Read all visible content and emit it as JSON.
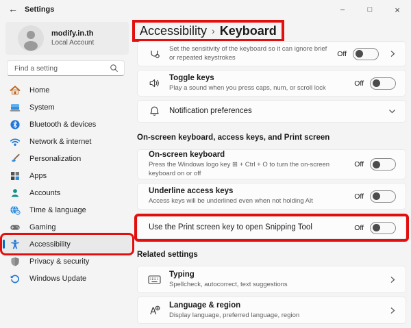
{
  "titlebar": {
    "back": "←",
    "title": "Settings",
    "minimize": "–",
    "maximize": "□",
    "close": "×"
  },
  "account": {
    "name": "modify.in.th",
    "type": "Local Account"
  },
  "search": {
    "placeholder": "Find a setting"
  },
  "sidebar": {
    "items": [
      {
        "label": "Home",
        "icon": "home-icon"
      },
      {
        "label": "System",
        "icon": "system-icon"
      },
      {
        "label": "Bluetooth & devices",
        "icon": "bluetooth-icon"
      },
      {
        "label": "Network & internet",
        "icon": "network-icon"
      },
      {
        "label": "Personalization",
        "icon": "personalization-icon"
      },
      {
        "label": "Apps",
        "icon": "apps-icon"
      },
      {
        "label": "Accounts",
        "icon": "accounts-icon"
      },
      {
        "label": "Time & language",
        "icon": "time-language-icon"
      },
      {
        "label": "Gaming",
        "icon": "gaming-icon"
      },
      {
        "label": "Accessibility",
        "icon": "accessibility-icon",
        "selected": true,
        "annotated": true
      },
      {
        "label": "Privacy & security",
        "icon": "privacy-icon"
      },
      {
        "label": "Windows Update",
        "icon": "windows-update-icon"
      }
    ]
  },
  "breadcrumb": {
    "parent": "Accessibility",
    "separator": "›",
    "current": "Keyboard"
  },
  "content": {
    "sections": {
      "onscreen": "On-screen keyboard, access keys, and Print screen",
      "related": "Related settings"
    },
    "rows": {
      "filter_keys": {
        "description": "Set the sensitivity of the keyboard so it can ignore brief or repeated keystrokes",
        "state": "Off"
      },
      "toggle_keys": {
        "title": "Toggle keys",
        "description": "Play a sound when you press caps, num, or scroll lock",
        "state": "Off"
      },
      "notification_preferences": {
        "title": "Notification preferences"
      },
      "on_screen_keyboard": {
        "title": "On-screen keyboard",
        "description": "Press the Windows logo key ⊞ + Ctrl + O to turn the on-screen keyboard on or off",
        "state": "Off"
      },
      "underline_access_keys": {
        "title": "Underline access keys",
        "description": "Access keys will be underlined even when not holding Alt",
        "state": "Off"
      },
      "print_screen": {
        "title": "Use the Print screen key to open Snipping Tool",
        "state": "Off",
        "annotated": true
      },
      "typing": {
        "title": "Typing",
        "description": "Spellcheck, autocorrect, text suggestions"
      },
      "language_region": {
        "title": "Language & region",
        "description": "Display language, preferred language, region"
      }
    }
  },
  "colors": {
    "accent": "#0067c0",
    "annotation_red": "#e30f0f"
  }
}
